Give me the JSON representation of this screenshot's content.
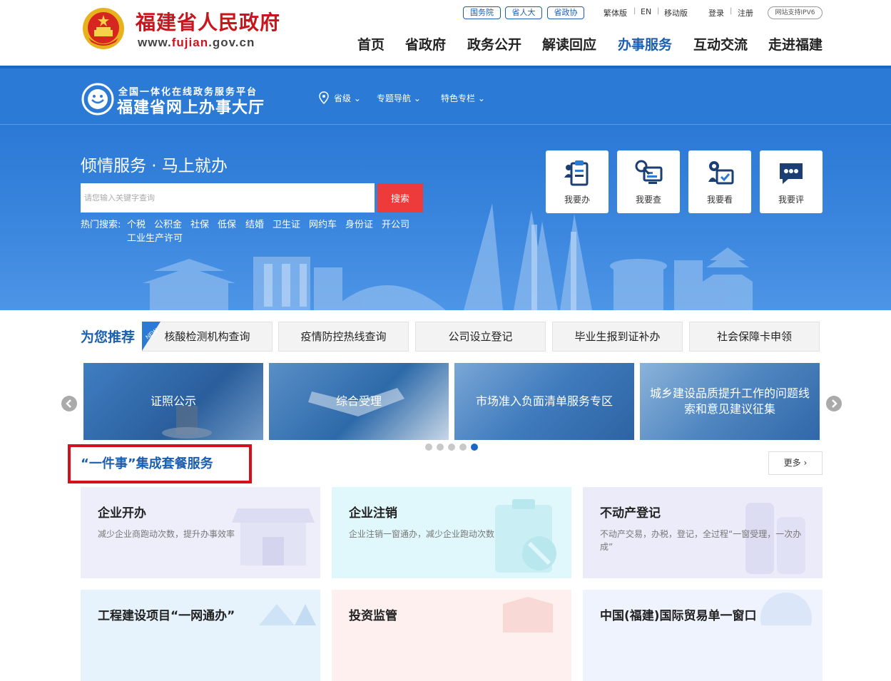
{
  "header": {
    "site_title": "福建省人民政府",
    "site_url_prefix": "www.",
    "site_url_highlight": "fujian",
    "site_url_suffix": ".gov.cn",
    "tags": [
      "国务院",
      "省人大",
      "省政协"
    ],
    "lang_links": [
      "繁体版",
      "EN",
      "移动版"
    ],
    "account_links": [
      "登录",
      "注册"
    ],
    "ipv6_label": "网站支持IPV6",
    "nav": [
      "首页",
      "省政府",
      "政务公开",
      "解读回应",
      "办事服务",
      "互动交流",
      "走进福建"
    ],
    "active_nav": "办事服务"
  },
  "hall": {
    "subtitle": "全国一体化在线政务服务平台",
    "title": "福建省网上办事大厅",
    "nav": [
      "省级",
      "专题导航",
      "特色专栏"
    ]
  },
  "hero": {
    "title": "倾情服务 · 马上就办",
    "search_placeholder": "请您输入关键字查询",
    "search_button": "搜索",
    "hot_label": "热门搜索:",
    "hot_terms": [
      "个税",
      "公积金",
      "社保",
      "低保",
      "结婚",
      "卫生证",
      "网约车",
      "身份证",
      "开公司",
      "工业生产许可"
    ],
    "quick_actions": [
      "我要办",
      "我要查",
      "我要看",
      "我要评"
    ]
  },
  "recommend": {
    "title": "为您推荐",
    "new_badge": "NEW",
    "items": [
      "核酸检测机构查询",
      "疫情防控热线查询",
      "公司设立登记",
      "毕业生报到证补办",
      "社会保障卡申领"
    ]
  },
  "carousel": {
    "slides": [
      "证照公示",
      "综合受理",
      "市场准入负面清单服务专区",
      "城乡建设品质提升工作的问题线索和意见建议征集"
    ],
    "dot_count": 5,
    "active_dot": 5
  },
  "packages": {
    "title": "“一件事”集成套餐服务",
    "more_label": "更多",
    "cards": [
      {
        "title": "企业开办",
        "desc": "减少企业商跑动次数，提升办事效率"
      },
      {
        "title": "企业注销",
        "desc": "企业注销一窗通办，减少企业跑动次数"
      },
      {
        "title": "不动产登记",
        "desc": "不动产交易，办税，登记，全过程“一窗受理，一次办成”"
      },
      {
        "title": "工程建设项目“一网通办”",
        "desc": ""
      },
      {
        "title": "投资监管",
        "desc": ""
      },
      {
        "title": "中国(福建)国际贸易单一窗口",
        "desc": ""
      }
    ]
  },
  "colors": {
    "brand_red": "#c8161e",
    "brand_blue": "#1b5fb3",
    "hero_blue": "#2b7ad6",
    "search_red": "#ed3b3b"
  }
}
